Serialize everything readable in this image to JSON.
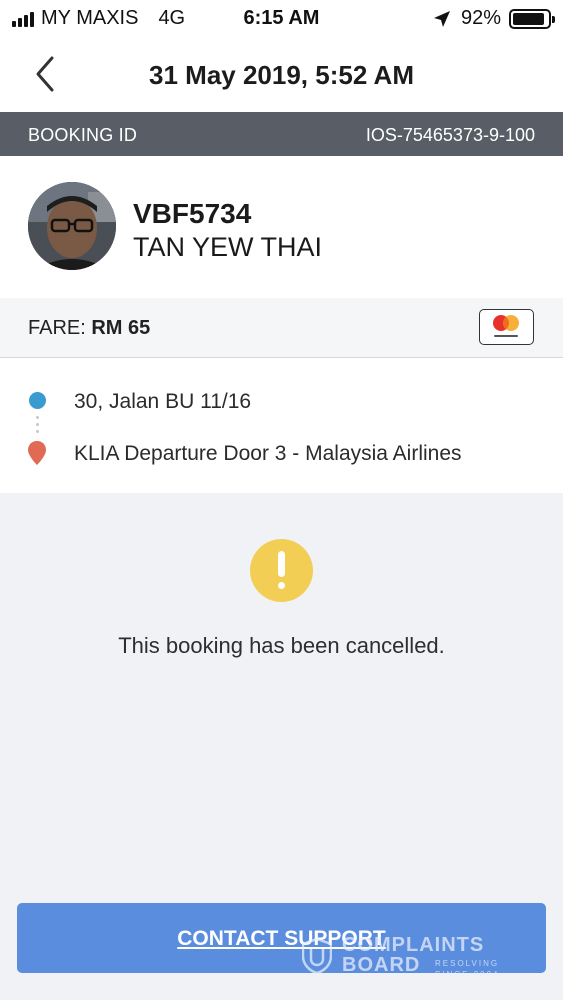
{
  "status_bar": {
    "carrier": "MY MAXIS",
    "network": "4G",
    "time": "6:15 AM",
    "battery": "92%",
    "battery_level": 0.92,
    "icons": [
      "signal-icon",
      "location-arrow-icon",
      "battery-icon"
    ]
  },
  "header": {
    "title": "31 May 2019, 5:52 AM",
    "back_icon": "chevron-left-icon"
  },
  "booking": {
    "label": "BOOKING ID",
    "id": "IOS-75465373-9-100"
  },
  "driver": {
    "plate": "VBF5734",
    "name": "TAN YEW THAI"
  },
  "fare": {
    "label": "FARE:",
    "amount": "RM 65",
    "payment_brand": "mastercard"
  },
  "route": {
    "pickup": "30, Jalan BU 11/16",
    "dropoff": "KLIA Departure Door 3 - Malaysia Airlines"
  },
  "status": {
    "message": "This booking has been cancelled."
  },
  "actions": {
    "support_label": "CONTACT SUPPORT"
  },
  "watermark": {
    "line1": "COMPLAINTS",
    "line2": "BOARD",
    "tag1": "RESOLVING",
    "tag2": "SINCE 2004"
  },
  "colors": {
    "booking_bar": "#585d66",
    "pickup_dot": "#3a9bd1",
    "dropoff_pin": "#e06a54",
    "warning": "#f3ce55",
    "support_button": "#5b8ddf",
    "background": "#f1f2f6"
  }
}
